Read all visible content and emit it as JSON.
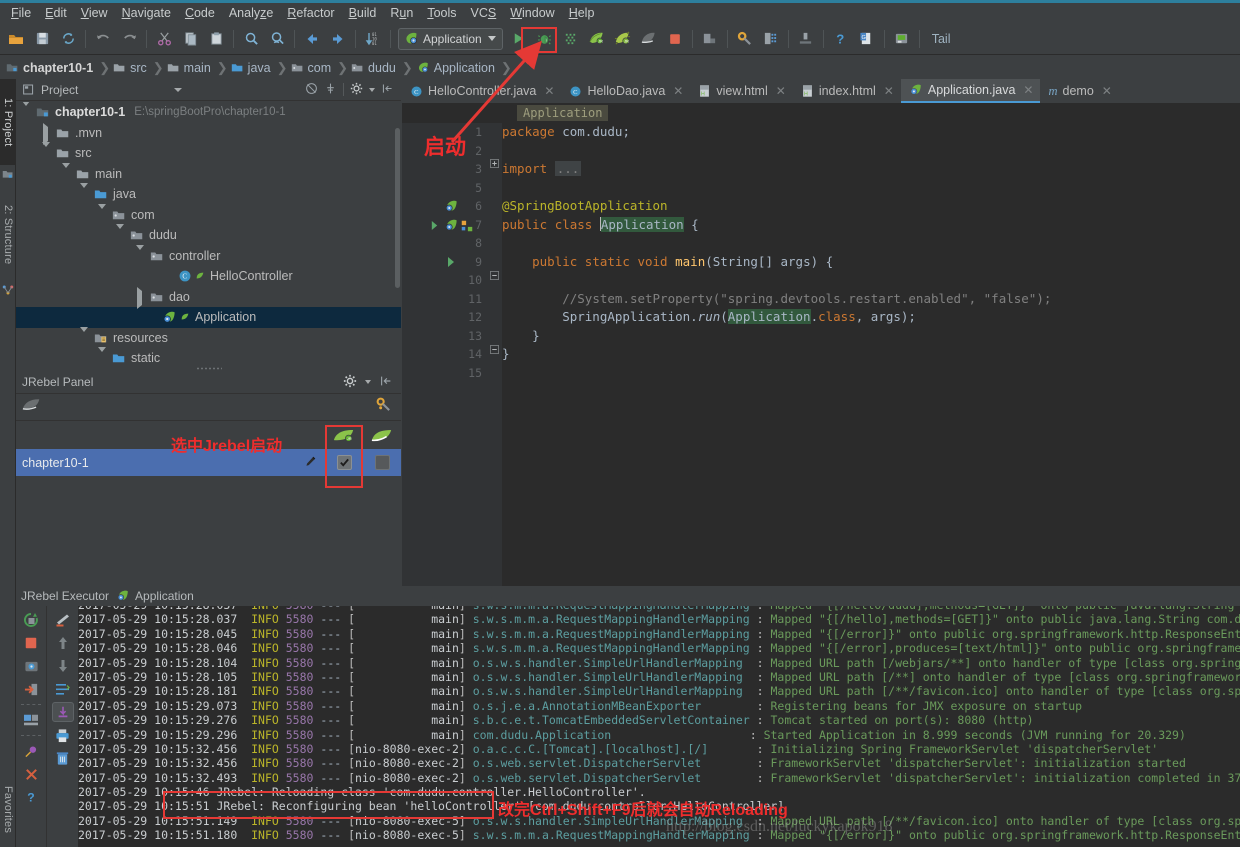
{
  "menu": {
    "items": [
      "File",
      "Edit",
      "View",
      "Navigate",
      "Code",
      "Analyze",
      "Refactor",
      "Build",
      "Run",
      "Tools",
      "VCS",
      "Window",
      "Help"
    ]
  },
  "toolbar": {
    "run_config_label": "Application",
    "tail_label": "Tail",
    "icons": [
      "open-folder-icon",
      "save-all-icon",
      "sync-icon",
      "undo-icon",
      "redo-icon",
      "cut-icon",
      "copy-icon",
      "paste-icon",
      "find-icon",
      "find-replace-icon",
      "back-icon",
      "forward-icon",
      "compile-icon",
      "run-icon",
      "debug-icon",
      "coverage-icon",
      "jrebel-run-icon",
      "jrebel-debug-icon",
      "jrebel-profile-icon",
      "stop-icon",
      "settings-project-icon",
      "settings-icon",
      "project-structure-icon",
      "sdk-icon",
      "help-icon",
      "update-icon",
      "database-icon"
    ]
  },
  "breadcrumb": {
    "items": [
      {
        "label": "chapter10-1",
        "icon": "module-icon"
      },
      {
        "label": "src",
        "icon": "folder-icon"
      },
      {
        "label": "main",
        "icon": "folder-icon"
      },
      {
        "label": "java",
        "icon": "source-folder-icon"
      },
      {
        "label": "com",
        "icon": "package-icon"
      },
      {
        "label": "dudu",
        "icon": "package-icon"
      },
      {
        "label": "Application",
        "icon": "spring-class-icon"
      }
    ]
  },
  "left_strips": {
    "project_tab": "1: Project",
    "structure_tab": "2: Structure",
    "favorites_tab": "Favorites"
  },
  "project_panel": {
    "title": "Project",
    "icons": [
      "project-view-icon",
      "collapse-all-icon",
      "expand-icon",
      "gear-icon",
      "hide-icon"
    ],
    "tree": [
      {
        "label": "chapter10-1",
        "path": "E:\\springBootPro\\chapter10-1",
        "depth": 0,
        "state": "expanded",
        "icon": "module-icon",
        "bold": true,
        "selected": false
      },
      {
        "label": ".mvn",
        "path": "",
        "depth": 1,
        "state": "collapsed",
        "icon": "folder-icon",
        "bold": false,
        "selected": false
      },
      {
        "label": "src",
        "path": "",
        "depth": 1,
        "state": "expanded",
        "icon": "folder-icon",
        "bold": false,
        "selected": false
      },
      {
        "label": "main",
        "path": "",
        "depth": 2,
        "state": "expanded",
        "icon": "folder-icon",
        "bold": false,
        "selected": false
      },
      {
        "label": "java",
        "path": "",
        "depth": 3,
        "state": "expanded",
        "icon": "source-folder-icon",
        "bold": false,
        "selected": false
      },
      {
        "label": "com",
        "path": "",
        "depth": 4,
        "state": "expanded",
        "icon": "package-icon",
        "bold": false,
        "selected": false
      },
      {
        "label": "dudu",
        "path": "",
        "depth": 5,
        "state": "expanded",
        "icon": "package-icon",
        "bold": false,
        "selected": false
      },
      {
        "label": "controller",
        "path": "",
        "depth": 6,
        "state": "expanded",
        "icon": "package-icon",
        "bold": false,
        "selected": false
      },
      {
        "label": "HelloController",
        "path": "",
        "depth": 7,
        "state": "leaf",
        "icon": "java-class-icon",
        "bold": false,
        "selected": false
      },
      {
        "label": "dao",
        "path": "",
        "depth": 6,
        "state": "collapsed",
        "icon": "package-icon",
        "bold": false,
        "selected": false
      },
      {
        "label": "Application",
        "path": "",
        "depth": 6,
        "state": "leaf",
        "icon": "spring-class-icon",
        "bold": false,
        "selected": true
      },
      {
        "label": "resources",
        "path": "",
        "depth": 3,
        "state": "expanded",
        "icon": "resource-folder-icon",
        "bold": false,
        "selected": false
      },
      {
        "label": "static",
        "path": "",
        "depth": 4,
        "state": "expanded",
        "icon": "source-folder-icon",
        "bold": false,
        "selected": false
      }
    ]
  },
  "jrebel_panel": {
    "title": "JRebel Panel",
    "row_name": "chapter10-1",
    "column_icons": [
      "jrebel-run-column-icon",
      "jrebel-debug-column-icon"
    ],
    "head_icons": [
      "gear-icon",
      "hide-icon"
    ],
    "toolbar_icons": [
      "jrebel-logo-icon",
      "jrebel-config-icon"
    ],
    "row_icons": [
      "pencil-edit-icon",
      "checkbox-checked",
      "checkbox-unchecked"
    ]
  },
  "editor": {
    "tabs": [
      {
        "label": "HelloController.java",
        "icon": "java-class-icon",
        "active": false
      },
      {
        "label": "HelloDao.java",
        "icon": "java-class-icon",
        "active": false
      },
      {
        "label": "view.html",
        "icon": "html-file-icon",
        "active": false
      },
      {
        "label": "index.html",
        "icon": "html-file-icon",
        "active": false
      },
      {
        "label": "Application.java",
        "icon": "spring-class-icon",
        "active": true
      },
      {
        "label": "demo",
        "icon": "maven-module-icon",
        "active": false
      }
    ],
    "breadcrumb_chip": "Application",
    "line_numbers": [
      "1",
      "2",
      "3",
      "5",
      "6",
      "7",
      "8",
      "9",
      "10",
      "11",
      "12",
      "13",
      "14",
      "15"
    ],
    "code_lines": [
      {
        "n": "1",
        "text": "package com.dudu;"
      },
      {
        "n": "2",
        "text": ""
      },
      {
        "n": "3",
        "text": "import ..."
      },
      {
        "n": "5",
        "text": ""
      },
      {
        "n": "6",
        "text": "@SpringBootApplication"
      },
      {
        "n": "7",
        "text": "public class Application {"
      },
      {
        "n": "8",
        "text": ""
      },
      {
        "n": "9",
        "text": "    public static void main(String[] args) {"
      },
      {
        "n": "10",
        "text": ""
      },
      {
        "n": "11",
        "text": "        //System.setProperty(\"spring.devtools.restart.enabled\", \"false\");"
      },
      {
        "n": "12",
        "text": "        SpringApplication.run(Application.class, args);"
      },
      {
        "n": "13",
        "text": "    }"
      },
      {
        "n": "14",
        "text": "}"
      },
      {
        "n": "15",
        "text": ""
      }
    ]
  },
  "console": {
    "tab_label": "JRebel Executor",
    "app_label": "Application",
    "toolbar_icons": [
      "rerun-icon",
      "stop-icon",
      "dump-threads-icon",
      "exit-icon",
      "console-settings-icon",
      "pin-icon",
      "close-icon",
      "help-icon"
    ],
    "toolbar2_icons": [
      "soft-wrap-icon",
      "scroll-up-icon",
      "scroll-down-icon",
      "wrap-lines-icon",
      "scroll-to-end-icon",
      "print-icon",
      "trash-icon"
    ],
    "lines": [
      {
        "ts": "2017-05-29 10:15:28.037",
        "lvl": "INFO",
        "pid": "5580",
        "thread": "main",
        "logger": "s.w.s.m.m.a.RequestMappingHandlerMapping",
        "msg": "Mapped \"{[/hello/dudu],methods=[GET]}\" onto public java.lang.String c",
        "partial": true
      },
      {
        "ts": "2017-05-29 10:15:28.037",
        "lvl": "INFO",
        "pid": "5580",
        "thread": "main",
        "logger": "s.w.s.m.m.a.RequestMappingHandlerMapping",
        "msg": "Mapped \"{[/hello],methods=[GET]}\" onto public java.lang.String com.du",
        "partial": false
      },
      {
        "ts": "2017-05-29 10:15:28.045",
        "lvl": "INFO",
        "pid": "5580",
        "thread": "main",
        "logger": "s.w.s.m.m.a.RequestMappingHandlerMapping",
        "msg": "Mapped \"{[/error]}\" onto public org.springframework.http.ResponseEnti",
        "partial": false
      },
      {
        "ts": "2017-05-29 10:15:28.046",
        "lvl": "INFO",
        "pid": "5580",
        "thread": "main",
        "logger": "s.w.s.m.m.a.RequestMappingHandlerMapping",
        "msg": "Mapped \"{[/error],produces=[text/html]}\" onto public org.springframew",
        "partial": false
      },
      {
        "ts": "2017-05-29 10:15:28.104",
        "lvl": "INFO",
        "pid": "5580",
        "thread": "main",
        "logger": "o.s.w.s.handler.SimpleUrlHandlerMapping",
        "msg": "Mapped URL path [/webjars/**] onto handler of type [class org.spring",
        "partial": false
      },
      {
        "ts": "2017-05-29 10:15:28.105",
        "lvl": "INFO",
        "pid": "5580",
        "thread": "main",
        "logger": "o.s.w.s.handler.SimpleUrlHandlerMapping",
        "msg": "Mapped URL path [/**] onto handler of type [class org.springframework",
        "partial": false
      },
      {
        "ts": "2017-05-29 10:15:28.181",
        "lvl": "INFO",
        "pid": "5580",
        "thread": "main",
        "logger": "o.s.w.s.handler.SimpleUrlHandlerMapping",
        "msg": "Mapped URL path [/**/favicon.ico] onto handler of type [class org.spr",
        "partial": false
      },
      {
        "ts": "2017-05-29 10:15:29.073",
        "lvl": "INFO",
        "pid": "5580",
        "thread": "main",
        "logger": "o.s.j.e.a.AnnotationMBeanExporter",
        "msg": "Registering beans for JMX exposure on startup",
        "partial": false
      },
      {
        "ts": "2017-05-29 10:15:29.276",
        "lvl": "INFO",
        "pid": "5580",
        "thread": "main",
        "logger": "s.b.c.e.t.TomcatEmbeddedServletContainer",
        "msg": "Tomcat started on port(s): 8080 (http)",
        "partial": false
      },
      {
        "ts": "2017-05-29 10:15:29.296",
        "lvl": "INFO",
        "pid": "5580",
        "thread": "main",
        "logger": "com.dudu.Application",
        "msg": "Started Application in 8.999 seconds (JVM running for 20.329)",
        "partial": false
      },
      {
        "ts": "2017-05-29 10:15:32.456",
        "lvl": "INFO",
        "pid": "5580",
        "thread": "nio-8080-exec-2",
        "logger": "o.a.c.c.C.[Tomcat].[localhost].[/]",
        "msg": "Initializing Spring FrameworkServlet 'dispatcherServlet'",
        "partial": false
      },
      {
        "ts": "2017-05-29 10:15:32.456",
        "lvl": "INFO",
        "pid": "5580",
        "thread": "nio-8080-exec-2",
        "logger": "o.s.web.servlet.DispatcherServlet",
        "msg": "FrameworkServlet 'dispatcherServlet': initialization started",
        "partial": false
      },
      {
        "ts": "2017-05-29 10:15:32.493",
        "lvl": "INFO",
        "pid": "5580",
        "thread": "nio-8080-exec-2",
        "logger": "o.s.web.servlet.DispatcherServlet",
        "msg": "FrameworkServlet 'dispatcherServlet': initialization completed in 37",
        "partial": false
      }
    ],
    "jrebel_lines": [
      {
        "text": "2017-05-29 10:15:46 JRebel: Reloading class 'com.dudu.controller.HelloController'."
      },
      {
        "text": "2017-05-29 10:15:51 JRebel: Reconfiguring bean 'helloController' [com.dudu.controller.HelloController]"
      }
    ],
    "tail_lines": [
      {
        "ts": "2017-05-29 10:15:51.149",
        "lvl": "INFO",
        "pid": "5580",
        "thread": "nio-8080-exec-5",
        "logger": "o.s.w.s.handler.SimpleUrlHandlerMapping",
        "msg": "Mapped URL path [/**/favicon.ico] onto handler of type [class org.sp",
        "partial": false
      },
      {
        "ts": "2017-05-29 10:15:51.180",
        "lvl": "INFO",
        "pid": "5580",
        "thread": "nio-8080-exec-5",
        "logger": "s.w.s.m.m.a.RequestMappingHandlerMapping",
        "msg": "Mapped \"{[/error]}\" onto public org.springframework.http.ResponseEnt",
        "partial": true
      }
    ]
  },
  "annotations": {
    "start_label": "启动",
    "jrebel_select_label": "选中Jrebel启动",
    "reload_label": "改完Ctrl+Shift+F9后就会自动Reloading",
    "watermark": "http://blog.csdn.net/luckykapok918",
    "accent_red": "#ef2d2d"
  }
}
